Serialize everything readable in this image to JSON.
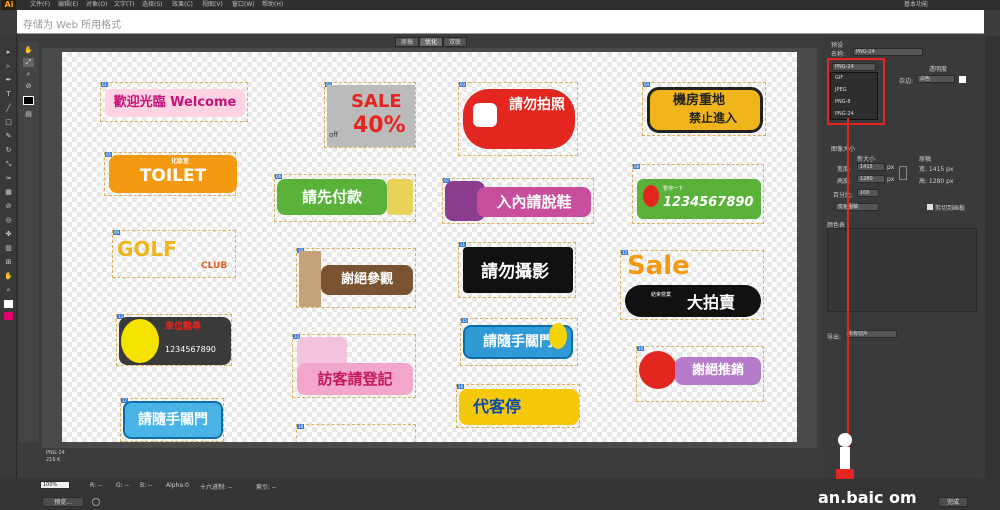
{
  "app": {
    "logo": "Ai",
    "menus": [
      "文件(F)",
      "编辑(E)",
      "对象(O)",
      "文字(T)",
      "选择(S)",
      "效果(C)",
      "视图(V)",
      "窗口(W)",
      "帮助(H)"
    ],
    "workspace": "基本功能"
  },
  "dialog": {
    "title": "存储为 Web 所用格式"
  },
  "tabs": [
    "原稿",
    "优化",
    "双联"
  ],
  "preset": {
    "section": "预设",
    "name_label": "名称:",
    "name_value": "PNG-24",
    "format_value": "PNG-24",
    "transparency_label": "透明度",
    "matte_label": "杂边:",
    "matte_value": "白色"
  },
  "format_dropdown": {
    "options": [
      "GIF",
      "JPEG",
      "PNG-8",
      "PNG-24"
    ],
    "selected": "PNG-24"
  },
  "image_size": {
    "section": "图像大小",
    "new_size_label": "新大小",
    "original_label": "原稿",
    "width_label": "宽度:",
    "width_value": "1415",
    "height_label": "高度:",
    "height_value": "1280",
    "orig_width": "宽: 1415 px",
    "orig_height": "高: 1280 px",
    "percent_label": "百分比:",
    "percent_value": "100",
    "quality_value": "优化图稿",
    "clip_label": "剪切到画板",
    "unit": "px"
  },
  "color_table": {
    "section": "颜色表"
  },
  "export": {
    "label": "导出:",
    "value": "所有切片"
  },
  "canvas_info": {
    "format": "PNG-24",
    "size": "216 K"
  },
  "status": {
    "zoom": "100%",
    "r": "R: --",
    "g": "G: --",
    "b": "B: --",
    "alpha": "Alpha:0",
    "hex": "十六进制: --",
    "index": "索引: --"
  },
  "buttons": {
    "preview": "预览...",
    "done": "完成"
  },
  "watermark": "an.baic  om",
  "signs": [
    {
      "text": "歡迎光臨 Welcome"
    },
    {
      "text": "SALE",
      "sub": "40%",
      "small": "off"
    },
    {
      "text": "請勿拍照"
    },
    {
      "text": "機房重地",
      "sub": "禁止進入"
    },
    {
      "text": "TOILET",
      "sub": "化妝室"
    },
    {
      "text": "請先付款"
    },
    {
      "text": "入內請脫鞋"
    },
    {
      "text": "1234567890",
      "sub": "暫停一下"
    },
    {
      "text": "GOLF",
      "sub": "CLUB"
    },
    {
      "text": "謝絕參觀"
    },
    {
      "text": "請勿攝影"
    },
    {
      "text": "Sale",
      "sub": "大拍賣",
      "small": "結束營業"
    },
    {
      "text": "車位難尋",
      "sub": "1234567890"
    },
    {
      "text": "請隨手關門"
    },
    {
      "text": "訪客請登記"
    },
    {
      "text": "代客停"
    },
    {
      "text": "謝絕推銷"
    },
    {
      "text": "請隨手關門"
    }
  ]
}
